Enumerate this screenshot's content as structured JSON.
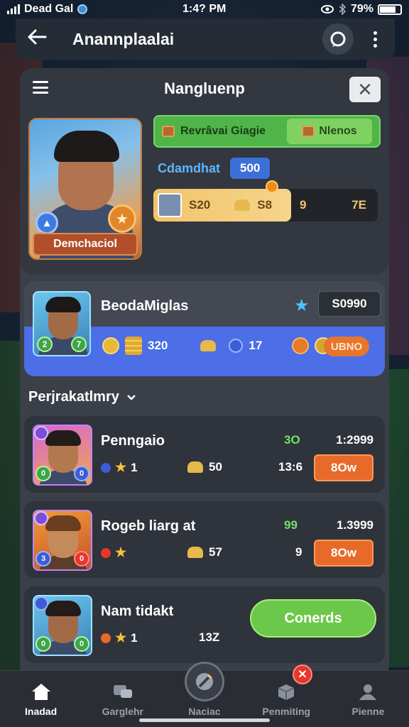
{
  "status_bar": {
    "carrier": "Dead Gal",
    "time": "1:4? PM",
    "battery": "79%",
    "battery_level": 0.79
  },
  "app_bar": {
    "title": "Anannplaalai"
  },
  "panel": {
    "title": "Nangluenp",
    "hero": {
      "name": "Demchaciol"
    },
    "reward_bar": {
      "label": "Revrâvai Giagie",
      "sub_label": "Nlenos"
    },
    "stat": {
      "label": "Cdamdhat",
      "value": "500"
    },
    "coin_bar": {
      "value_1": "S20",
      "value_2": "S8",
      "value_3": "9",
      "value_4": "7E"
    }
  },
  "featured": {
    "name": "BeodaMiglas",
    "price": "S0990",
    "avatar_left_badge": "2",
    "avatar_right_badge": "7",
    "stat_coins": "320",
    "stat_gems": "17",
    "badge": "UBNO"
  },
  "section_title": "Perjrakatlmry",
  "players": [
    {
      "name": "Penngaio",
      "stars": "1",
      "coins": "50",
      "score": "3O",
      "price": "1:2999",
      "extra": "13:6",
      "button": "8Ow",
      "left_badge": "0",
      "right_badge": "0"
    },
    {
      "name": "Rogeb liarg at",
      "stars": "",
      "coins": "57",
      "score": "99",
      "price": "1.3999",
      "extra": "9",
      "button": "8Ow",
      "left_badge": "3",
      "right_badge": "0"
    },
    {
      "name": "Nam tidakt",
      "stars": "1",
      "coins": "",
      "score": "",
      "price": "",
      "extra": "13Z",
      "button": "Conerds",
      "left_badge": "0",
      "right_badge": "0"
    }
  ],
  "bottom_nav": [
    {
      "label": "Inadad",
      "icon": "home-icon"
    },
    {
      "label": "Garglehr",
      "icon": "chat-icon"
    },
    {
      "label": "Naciac",
      "icon": "tools-icon"
    },
    {
      "label": "Penmiting",
      "icon": "box-icon"
    },
    {
      "label": "Pienne",
      "icon": "person-icon"
    }
  ]
}
